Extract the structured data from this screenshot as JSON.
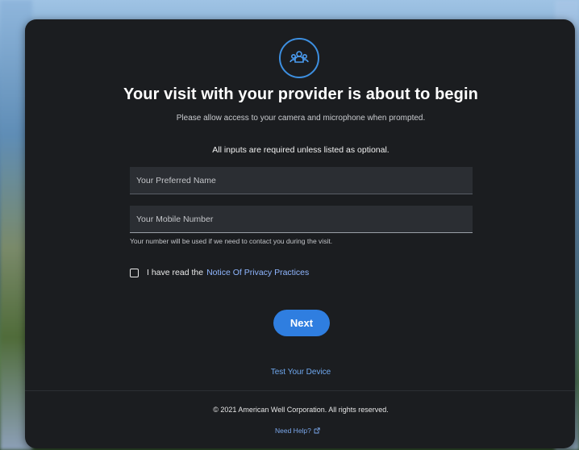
{
  "dialog": {
    "title": "Your visit with your provider is about to begin",
    "subtitle": "Please allow access to your camera and microphone when prompted.",
    "required_note": "All inputs are required unless listed as optional.",
    "logo_icon": "people-group-icon"
  },
  "form": {
    "name_placeholder": "Your Preferred Name",
    "name_value": "",
    "mobile_placeholder": "Your Mobile Number",
    "mobile_value": "",
    "mobile_helper": "Your number will be used if we need to contact you during the visit.",
    "privacy_checkbox_label": "I have read the",
    "privacy_link": "Notice Of Privacy Practices",
    "privacy_checked": false,
    "next_label": "Next"
  },
  "links": {
    "test_device": "Test Your Device",
    "need_help": "Need Help?",
    "need_help_icon": "external-link-icon"
  },
  "footer": {
    "copyright": "© 2021 American Well Corporation. All rights reserved."
  },
  "colors": {
    "accent": "#2f7ee0",
    "link": "#8fb6ff",
    "dialog_bg": "#1b1d20"
  }
}
